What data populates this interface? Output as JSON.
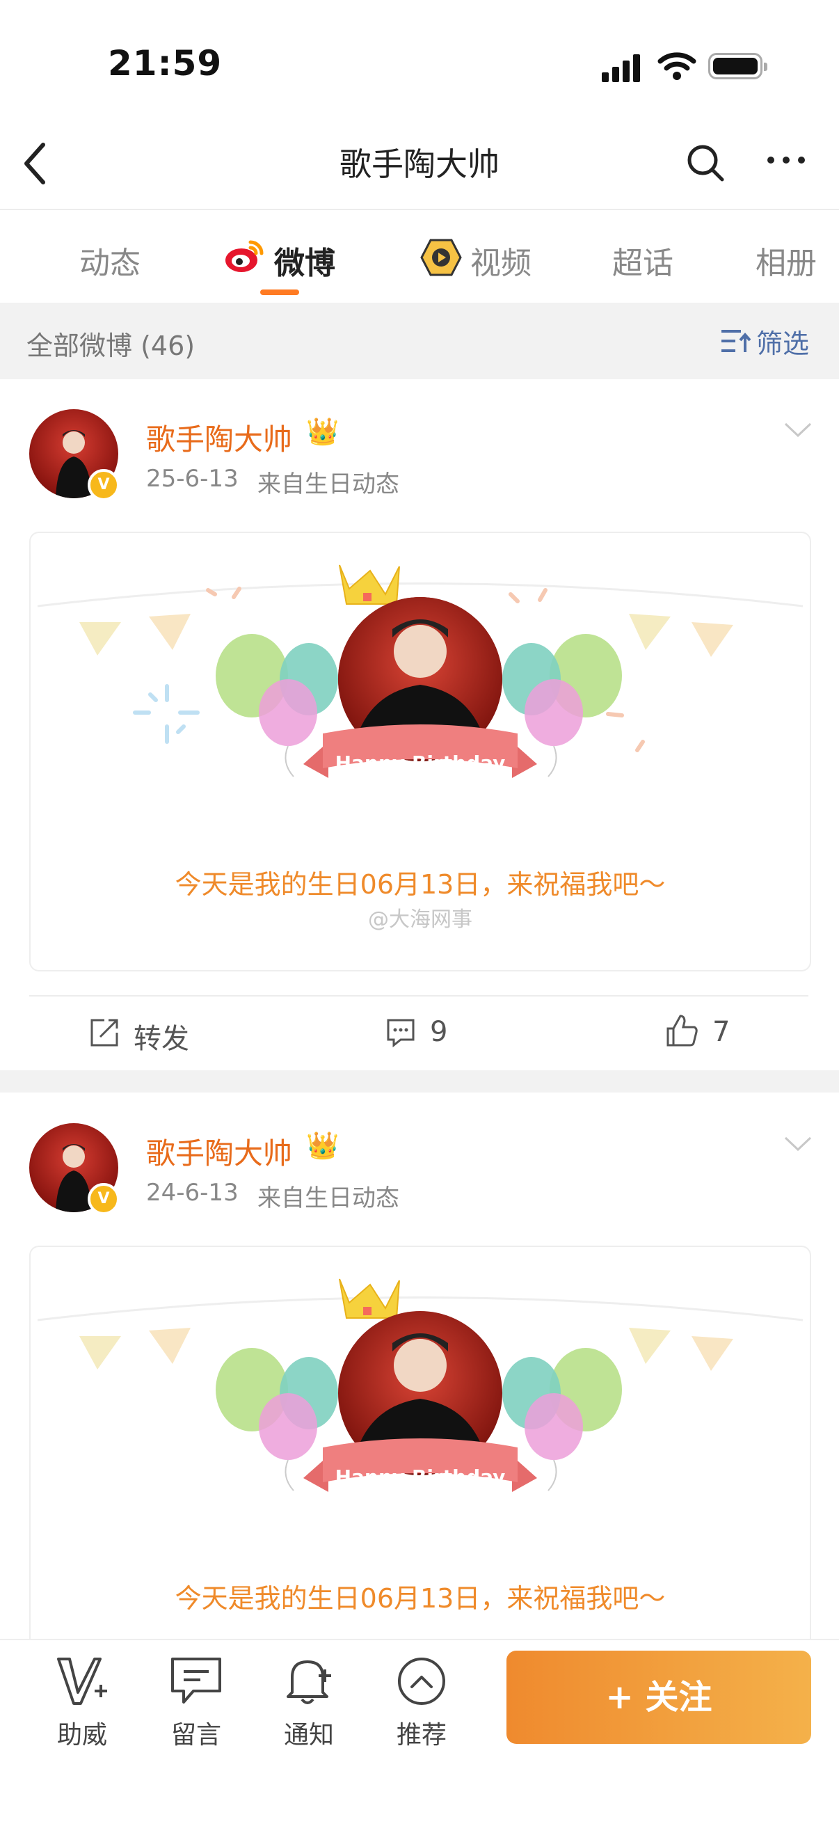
{
  "status_bar": {
    "time": "21:59"
  },
  "nav": {
    "title": "歌手陶大帅"
  },
  "tabs": [
    {
      "label": "动态"
    },
    {
      "label": "微博"
    },
    {
      "label": "视频"
    },
    {
      "label": "超话"
    },
    {
      "label": "相册"
    }
  ],
  "filter": {
    "count_label": "全部微博 (46)",
    "filter_label": "筛选"
  },
  "posts": [
    {
      "username": "歌手陶大帅",
      "date": "25-6-13",
      "source": "来自生日动态",
      "banner_text": "Happy Birthday",
      "message": "今天是我的生日06月13日，来祝福我吧～",
      "watermark": "@大海网事",
      "repost_label": "转发",
      "comments": "9",
      "likes": "7"
    },
    {
      "username": "歌手陶大帅",
      "date": "24-6-13",
      "source": "来自生日动态",
      "banner_text": "Happy Birthday",
      "message": "今天是我的生日06月13日，来祝福我吧～"
    }
  ],
  "bottom_bar": {
    "items": [
      {
        "label": "助威",
        "icon": "v-plus-icon"
      },
      {
        "label": "留言",
        "icon": "message-icon"
      },
      {
        "label": "通知",
        "icon": "bell-plus-icon"
      },
      {
        "label": "推荐",
        "icon": "chevron-up-circle-icon"
      }
    ],
    "follow_label": "+ 关注"
  },
  "colors": {
    "accent": "#e86b1b",
    "follow_start": "#ef8a2e",
    "follow_end": "#f4b14a",
    "filter_blue": "#4f6fa8"
  }
}
